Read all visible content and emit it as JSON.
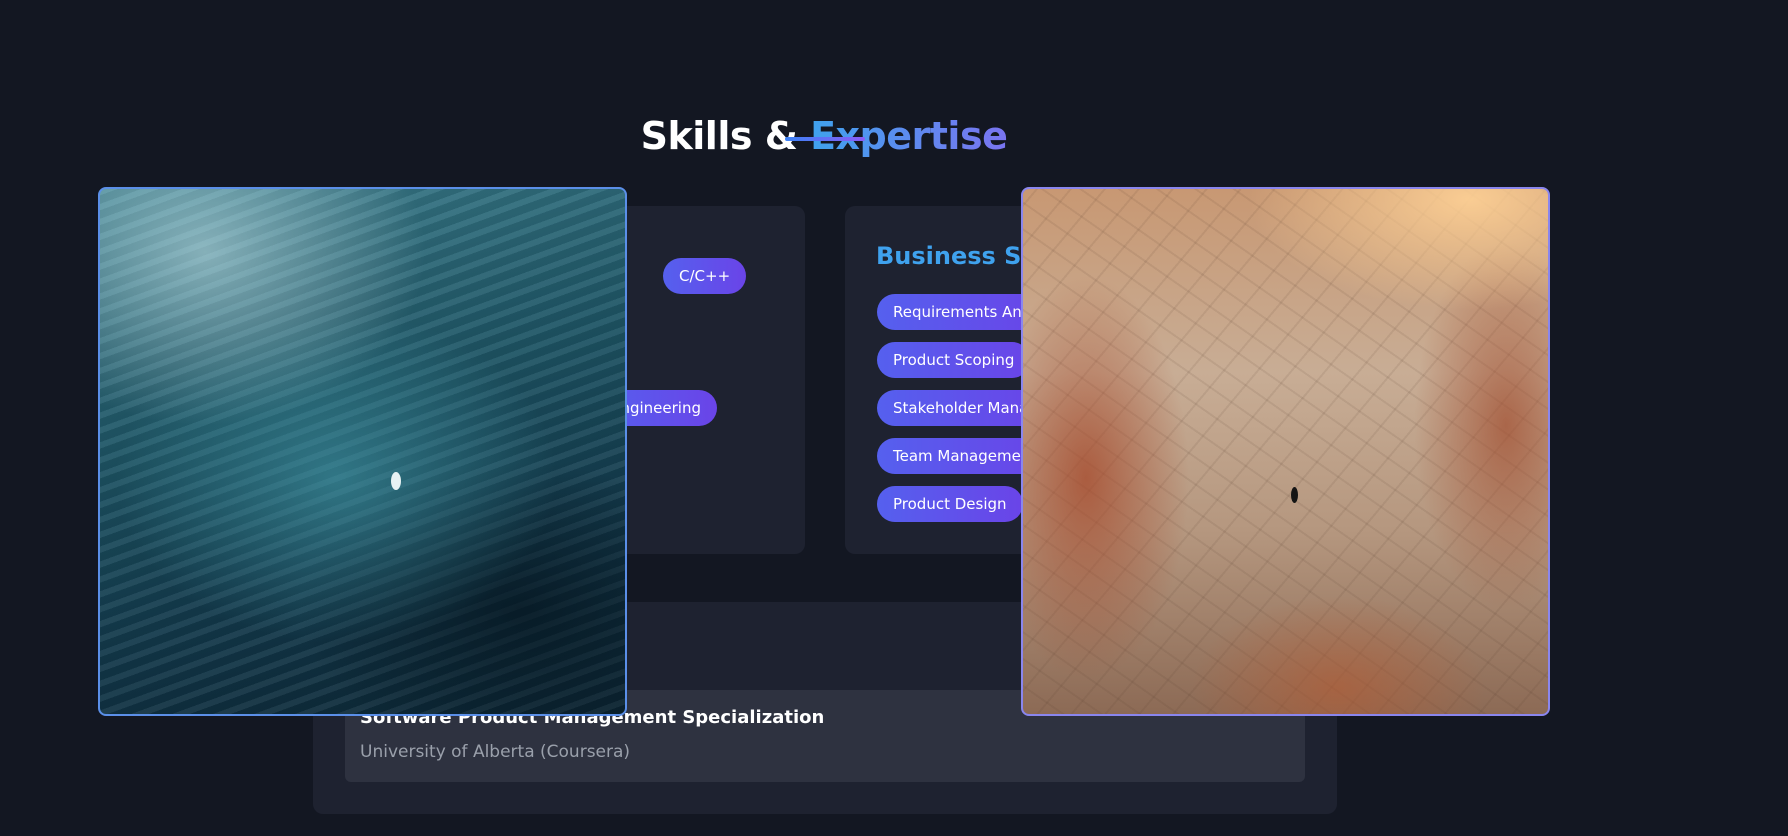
{
  "section": {
    "title_main": "Skills &",
    "title_accent": "Expertise"
  },
  "technical": {
    "skills": [
      "C/C++",
      "Engineering"
    ]
  },
  "business": {
    "heading": "Business Sk",
    "skills": [
      "Requirements Ana",
      "Product Scoping",
      "Stakeholder Mana",
      "Team Managemen",
      "Product Design"
    ]
  },
  "certifications": [
    {
      "name": "Software Product Management Specialization",
      "issuer": "University of Alberta (Coursera)"
    }
  ],
  "images": [
    {
      "name": "ocean-photo",
      "subject": "aerial ocean with swimmer"
    },
    {
      "name": "desert-photo",
      "subject": "cracked desert canyon with walker"
    }
  ],
  "colors": {
    "background": "#131722",
    "card": "#1e2230",
    "accent": "#3fa2ee",
    "pill": "#5a55ec"
  }
}
